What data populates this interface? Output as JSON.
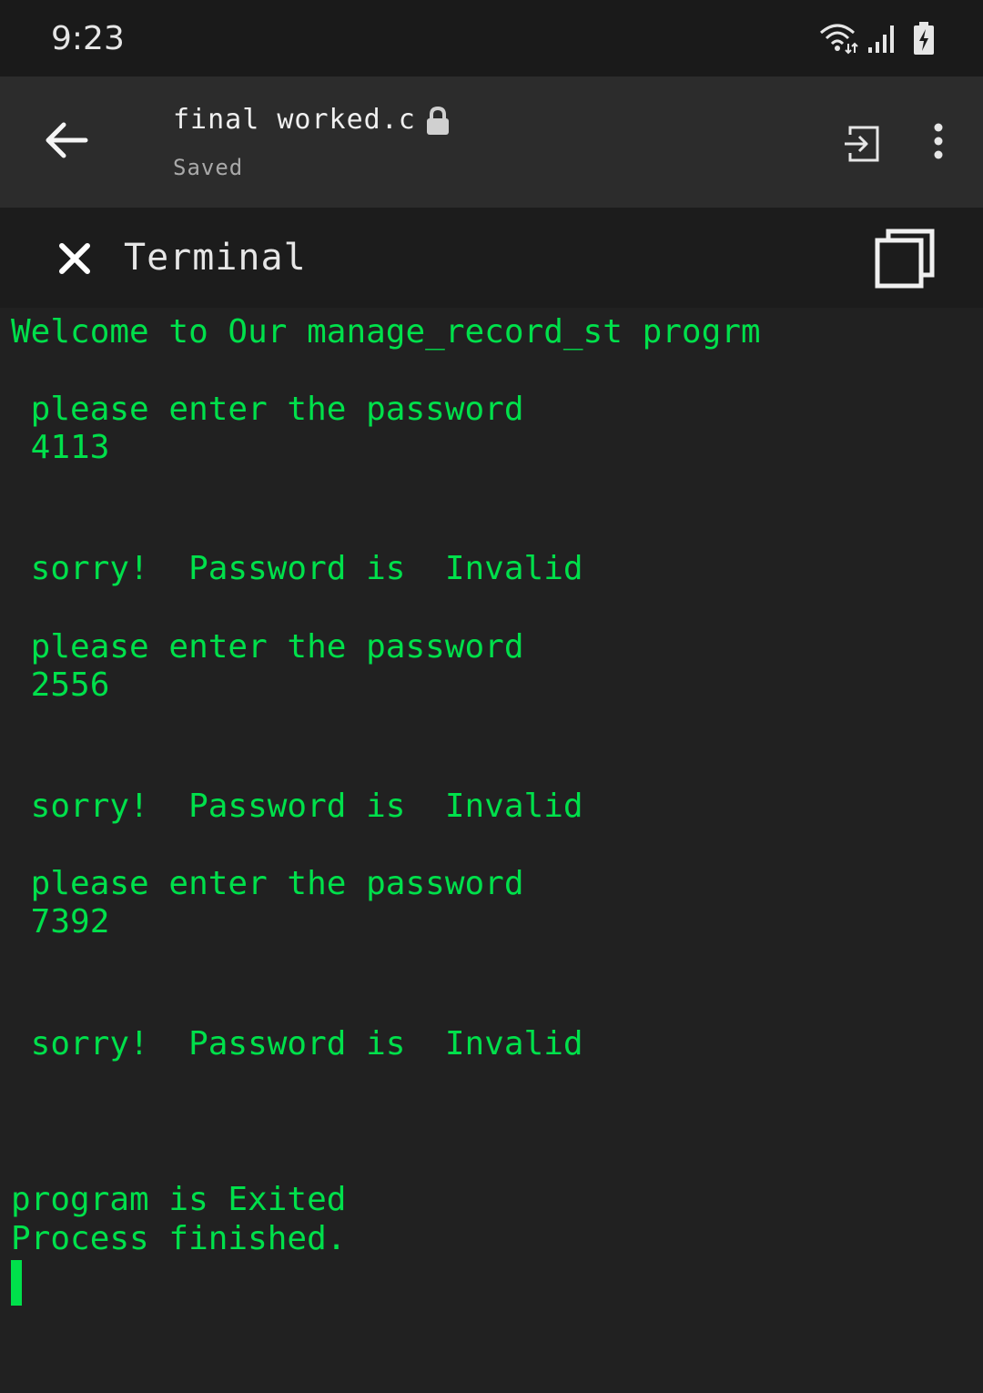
{
  "status_bar": {
    "time": "9:23",
    "icons": [
      "wifi-icon",
      "signal-icon",
      "battery-charging-icon"
    ]
  },
  "app_bar": {
    "back_icon": "arrow-left-icon",
    "file_name": "final worked.c",
    "lock_icon": "lock-icon",
    "file_status": "Saved",
    "exit_icon": "exit-icon",
    "more_icon": "more-vertical-icon"
  },
  "panel": {
    "close_icon": "close-icon",
    "title": "Terminal",
    "copy_icon": "copy-icon"
  },
  "terminal": {
    "lines": [
      "Welcome to Our manage_record_st progrm",
      " please enter the password",
      " 4113",
      " sorry!  Password is  Invalid",
      " please enter the password",
      " 2556",
      " sorry!  Password is  Invalid",
      " please enter the password",
      " 7392",
      " sorry!  Password is  Invalid",
      "program is Exited",
      "Process finished."
    ]
  },
  "colors": {
    "terminal_text": "#00e04b",
    "background": "#212121",
    "app_bar": "#2c2c2c"
  }
}
